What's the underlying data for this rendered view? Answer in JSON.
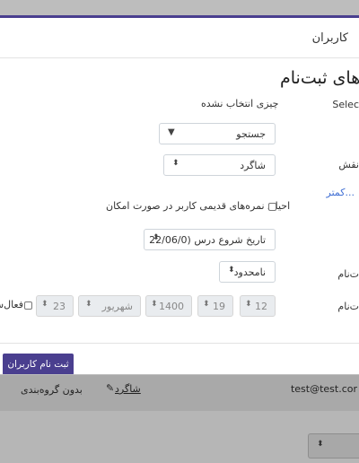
{
  "modal": {
    "title": "کاربران",
    "section_title": "مرهای ثبت‌نام",
    "select_users_label": "Selec",
    "nothing_selected": "چیزی انتخاب نشده",
    "search_select": {
      "value": "جستجو"
    },
    "role_label": "نقش",
    "role_select": {
      "value": "شاگرد"
    },
    "show_less_link": "کمتر...",
    "recover_grades": {
      "label": "احیای نمره‌های قدیمی کاربر در صورت امکان",
      "checked": false
    },
    "start_select": {
      "value": "تاریخ شروع درس (22/06/0"
    },
    "duration_label": "ت‌نام",
    "duration_select": {
      "value": "نامحدود"
    },
    "end_label": "ت‌نام",
    "date_fields": {
      "day": "12",
      "hour": "19",
      "year": "1400",
      "month": "شهریور",
      "minute": "23"
    },
    "enable_label": "فعال‌سا",
    "submit_button": "ثبت نام کاربران"
  },
  "background": {
    "row_email": "test@test.cor",
    "row_role": "شاگرد",
    "row_group": "بدون گروه‌بندی"
  }
}
